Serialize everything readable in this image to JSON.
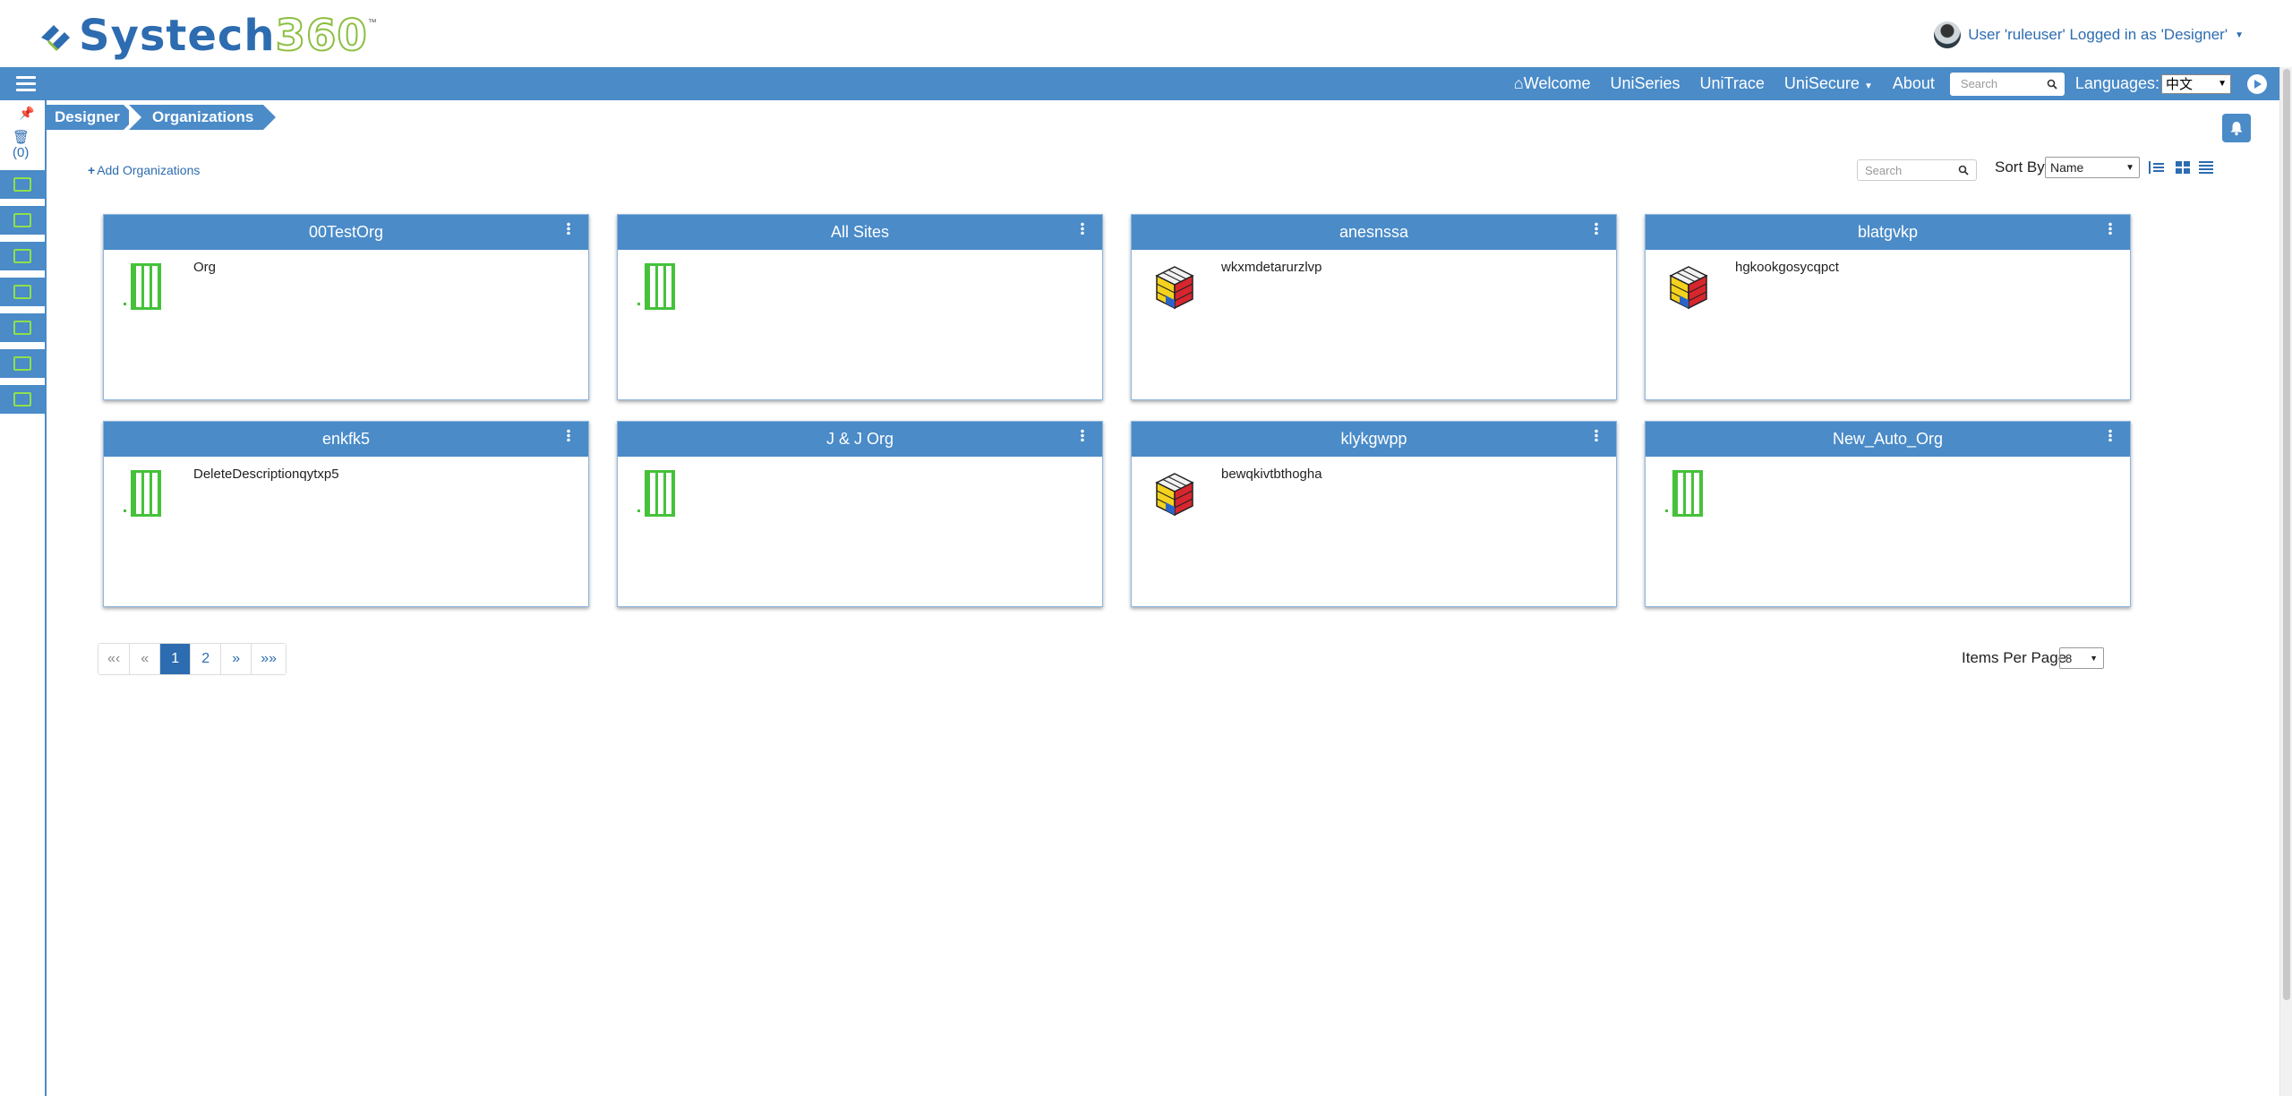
{
  "header": {
    "brand_primary": "Systech",
    "brand_secondary": "360",
    "trademark": "™",
    "user_text": "User 'ruleuser' Logged in as 'Designer'"
  },
  "nav": {
    "links": [
      "Welcome",
      "UniSeries",
      "UniTrace",
      "UniSecure",
      "About"
    ],
    "search_placeholder": "Search",
    "languages_label": "Languages:",
    "language_value": "中文"
  },
  "left_rail": {
    "trash_count": "(0)",
    "icons": [
      "hierarchy-icon",
      "site-icon",
      "line-icon",
      "factory-icon",
      "cloud-icon",
      "printer-icon",
      "device-icon"
    ]
  },
  "breadcrumb": {
    "items": [
      "Designer",
      "Organizations"
    ]
  },
  "toolbar": {
    "add_label": "Add Organizations",
    "search_placeholder": "Search",
    "sort_label": "Sort By",
    "sort_value": "Name"
  },
  "cards": [
    {
      "title": "00TestOrg",
      "description": "Org",
      "icon": "building-icon"
    },
    {
      "title": "All Sites",
      "description": "",
      "icon": "building-icon"
    },
    {
      "title": "anesnssa",
      "description": "wkxmdetarurzlvp",
      "icon": "cube-icon"
    },
    {
      "title": "blatgvkp",
      "description": "hgkookgosycqpct",
      "icon": "cube-icon"
    },
    {
      "title": "enkfk5",
      "description": "DeleteDescriptionqytxp5",
      "icon": "building-icon"
    },
    {
      "title": "J & J Org",
      "description": "",
      "icon": "building-icon"
    },
    {
      "title": "klykgwpp",
      "description": "bewqkivtbthogha",
      "icon": "cube-icon"
    },
    {
      "title": "New_Auto_Org",
      "description": "",
      "icon": "building-icon"
    }
  ],
  "pagination": {
    "first": "«‹",
    "prev": "«",
    "pages": [
      "1",
      "2"
    ],
    "current": "1",
    "next": "»",
    "last": "»»",
    "items_per_page_label": "Items Per Page",
    "items_per_page_value": "8"
  },
  "colors": {
    "nav_blue": "#4a8bc8",
    "link_blue": "#2d6cb0",
    "building_green": "#45c23a",
    "logo_green": "#8bbf3f"
  }
}
